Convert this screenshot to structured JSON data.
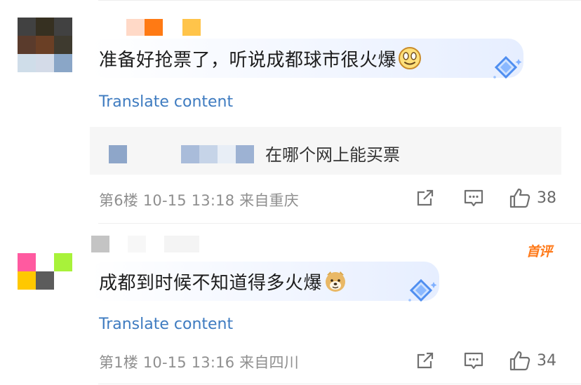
{
  "comments": [
    {
      "text": "准备好抢票了，听说成都球市很火爆",
      "emoji_icon": "smiling-face-emoji",
      "translate_label": "Translate content",
      "reply": {
        "text": "在哪个网上能买票"
      },
      "meta": "第6楼 10-15 13:18 来自重庆",
      "like_count": "38",
      "avatar_colors": [
        "#414141",
        "#363021",
        "#414141",
        "#5a3b2c",
        "#6a3f25",
        "#3e3a2f",
        "#cfdde9",
        "#d4dbe8",
        "#8aa6c7"
      ]
    },
    {
      "text": "成都到时候不知道得多火爆",
      "emoji_icon": "doge-emoji",
      "translate_label": "Translate content",
      "meta": "第1楼 10-15 13:16 来自四川",
      "like_count": "34",
      "badge": "首评",
      "avatar_colors": [
        "#ff5aa0",
        "#ffffff",
        "#a8f23a",
        "#ffc800",
        "#5c5c5c",
        "#ffffff",
        "#ffffff",
        "#ffffff",
        "#ffffff"
      ]
    }
  ],
  "colors": {
    "link": "#3e7bc0",
    "meta": "#8f8f8f",
    "badge": "#ff7a1a",
    "reply_bg": "#f6f6f6"
  },
  "icons": [
    "share-icon",
    "comment-icon",
    "like-icon",
    "gem-badge-icon"
  ]
}
